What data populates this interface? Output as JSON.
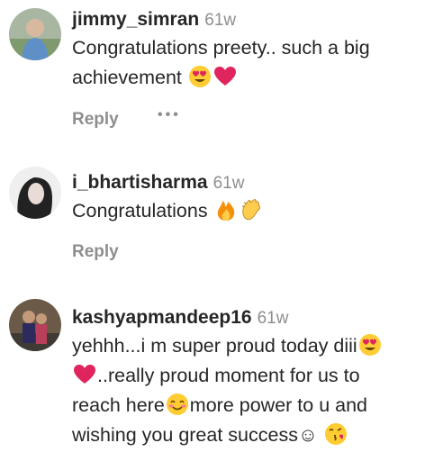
{
  "comments": [
    {
      "username": "jimmy_simran",
      "time": "61w",
      "line1": "Congratulations preety.. such a big",
      "line2": "achievement",
      "reply_label": "Reply",
      "more_label": "•••"
    },
    {
      "username": "i_bhartisharma",
      "time": "61w",
      "line1": "Congratulations",
      "reply_label": "Reply"
    },
    {
      "username": "kashyapmandeep16",
      "time": "61w",
      "line1": "yehhh...i m super proud today diii",
      "line2": "..really proud moment for us to",
      "line3": "reach here",
      "line3b": "more power to u and",
      "line4": "wishing you great success☺"
    }
  ],
  "icons": {
    "heart_eyes": "heart-eyes-emoji",
    "heart": "red-heart-emoji",
    "fire": "fire-emoji",
    "clap": "clapping-hands-emoji",
    "smile": "smiling-face-emoji",
    "kiss": "face-blowing-kiss-emoji"
  },
  "colors": {
    "text": "#262626",
    "muted": "#8e8e8e",
    "heart": "#e0245e",
    "emoji_yellow": "#ffcc33"
  }
}
